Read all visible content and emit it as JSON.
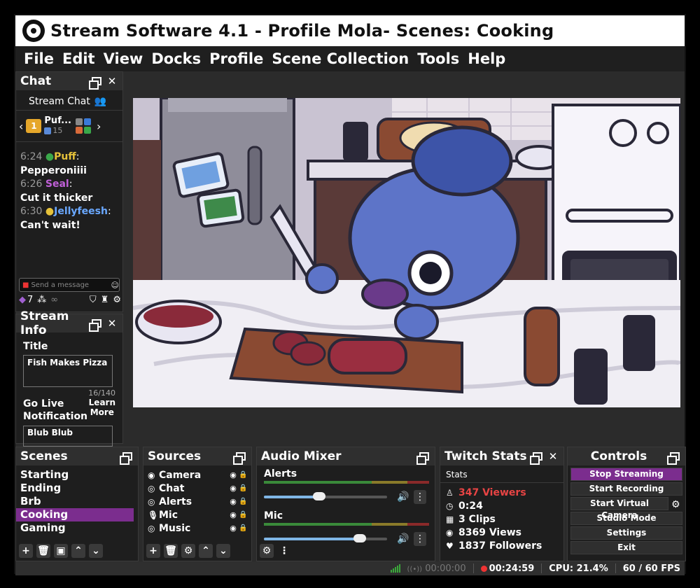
{
  "window": {
    "title": "Stream Software 4.1 - Profile Mola- Scenes: Cooking"
  },
  "menu": [
    "File",
    "Edit",
    "View",
    "Docks",
    "Profile",
    "Scene Collection",
    "Tools",
    "Help"
  ],
  "chat": {
    "header": "Chat",
    "subheader": "Stream Chat",
    "hype_gift_count": "1",
    "hype_user": "Puf...",
    "hype_sub_count": "15",
    "messages": [
      {
        "time": "6:24",
        "user": "Puff",
        "text": "Pepperoniiii"
      },
      {
        "time": "6:26",
        "user": "Seal",
        "text": "Cut it thicker"
      },
      {
        "time": "6:30",
        "user": "Jellyfeesh",
        "text": "Can't wait!"
      }
    ],
    "input_placeholder": "Send a message",
    "points": "7"
  },
  "stream_info": {
    "header": "Stream Info",
    "title_label": "Title",
    "title_value": "Fish Makes Pizza",
    "char_count": "16/140",
    "golive_label_1": "Go Live",
    "golive_label_2": "Notification",
    "learn_more_1": "Learn",
    "learn_more_2": "More",
    "notification_value": "Blub Blub"
  },
  "scenes": {
    "header": "Scenes",
    "items": [
      "Starting",
      "Ending",
      "Brb",
      "Cooking",
      "Gaming"
    ],
    "active": "Cooking"
  },
  "sources": {
    "header": "Sources",
    "items": [
      {
        "name": "Camera",
        "icon": "camera-icon"
      },
      {
        "name": "Chat",
        "icon": "globe-icon"
      },
      {
        "name": "Alerts",
        "icon": "globe-icon"
      },
      {
        "name": "Mic",
        "icon": "mic-icon"
      },
      {
        "name": "Music",
        "icon": "globe-icon"
      }
    ]
  },
  "audio_mixer": {
    "header": "Audio Mixer",
    "channels": [
      {
        "name": "Alerts",
        "volume": 0.45
      },
      {
        "name": "Mic",
        "volume": 0.78
      }
    ]
  },
  "twitch_stats": {
    "header": "Twitch Stats",
    "sub": "Stats",
    "viewers": "347 Viewers",
    "uptime": "0:24",
    "clips": "3 Clips",
    "views": "8369 Views",
    "followers": "1837 Followers"
  },
  "controls": {
    "header": "Controls",
    "buttons": [
      "Stop Streaming",
      "Start Recording",
      "Start Virtual Camera",
      "Studio Mode",
      "Settings",
      "Exit"
    ]
  },
  "status": {
    "rec_time": "00:00:00",
    "live_time": "00:24:59",
    "cpu": "CPU: 21.4%",
    "fps": "60 / 60 FPS"
  },
  "colors": {
    "accent": "#7b2d8e",
    "viewers": "#e84444",
    "puff": "#e6c23a",
    "seal": "#c060d8",
    "jelly": "#6aa8ff"
  }
}
